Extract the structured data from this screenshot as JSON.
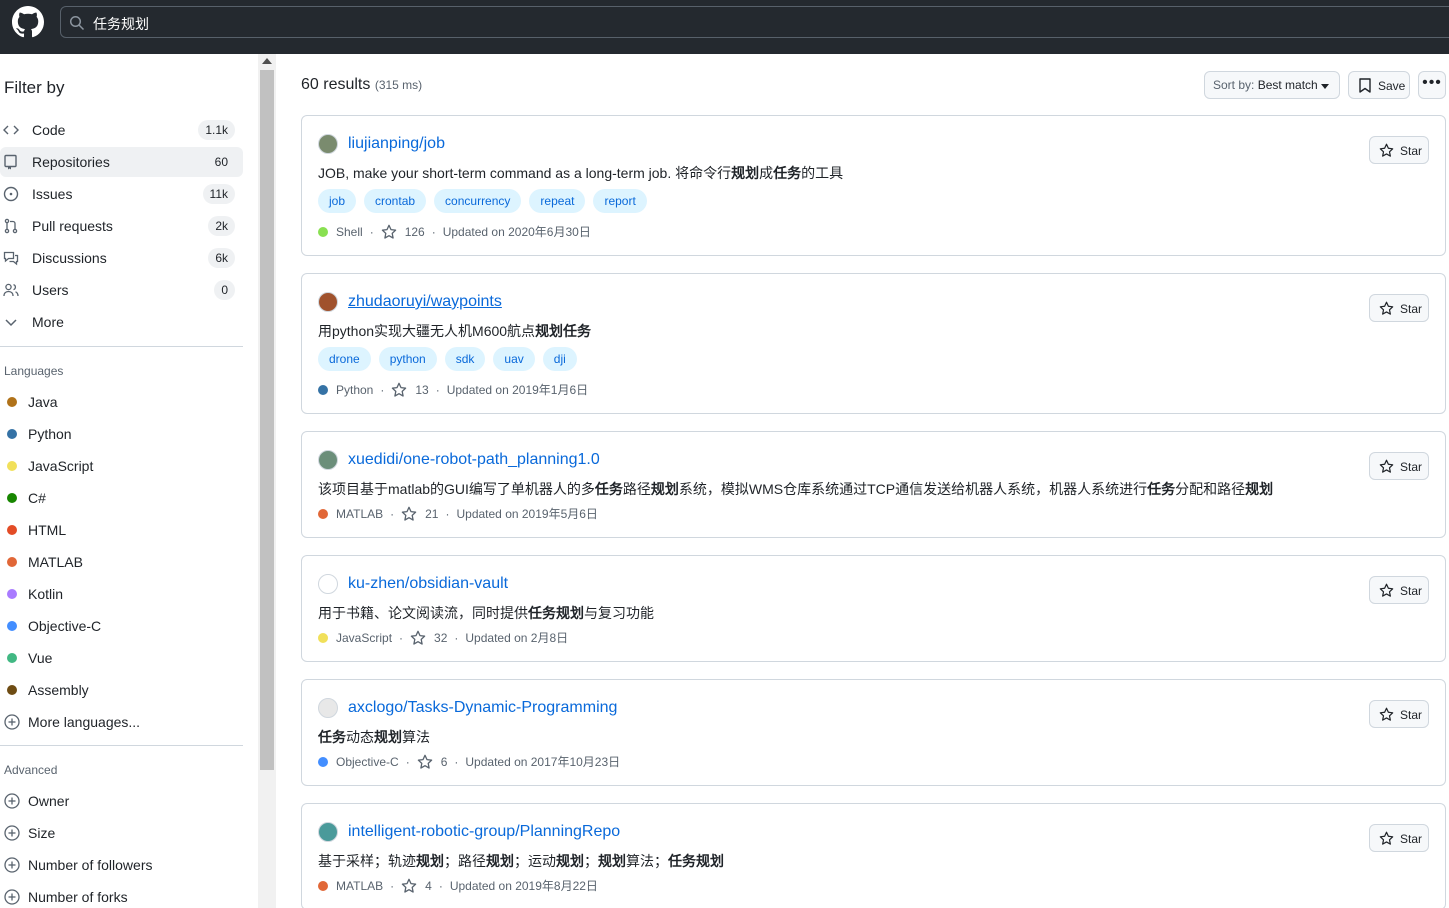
{
  "search": {
    "value": "任务规划"
  },
  "sidebar": {
    "filter_title": "Filter by",
    "types": [
      {
        "label": "Code",
        "count": "1.1k",
        "icon": "code-icon"
      },
      {
        "label": "Repositories",
        "count": "60",
        "icon": "repo-icon",
        "active": true
      },
      {
        "label": "Issues",
        "count": "11k",
        "icon": "issue-icon"
      },
      {
        "label": "Pull requests",
        "count": "2k",
        "icon": "pull-request-icon"
      },
      {
        "label": "Discussions",
        "count": "6k",
        "icon": "discussion-icon"
      },
      {
        "label": "Users",
        "count": "0",
        "icon": "people-icon"
      },
      {
        "label": "More",
        "icon": "chevron-down-icon"
      }
    ],
    "languages_label": "Languages",
    "languages": [
      {
        "label": "Java",
        "color": "#b07219"
      },
      {
        "label": "Python",
        "color": "#3572A5"
      },
      {
        "label": "JavaScript",
        "color": "#f1e05a"
      },
      {
        "label": "C#",
        "color": "#178600"
      },
      {
        "label": "HTML",
        "color": "#e34c26"
      },
      {
        "label": "MATLAB",
        "color": "#e16737"
      },
      {
        "label": "Kotlin",
        "color": "#A97BFF"
      },
      {
        "label": "Objective-C",
        "color": "#438eff"
      },
      {
        "label": "Vue",
        "color": "#41b883"
      },
      {
        "label": "Assembly",
        "color": "#6E4C13"
      }
    ],
    "more_languages": "More languages...",
    "advanced_label": "Advanced",
    "advanced": [
      "Owner",
      "Size",
      "Number of followers",
      "Number of forks"
    ]
  },
  "results": {
    "count": "60 results",
    "time": "(315 ms)",
    "sort_prefix": "Sort by:",
    "sort_value": "Best match",
    "save_label": "Save",
    "star_label": "Star",
    "items": [
      {
        "name": "liujianping/job",
        "desc": [
          [
            "JOB, make your short-term command as a long-term job. 将命令行",
            false
          ],
          [
            "规划",
            true
          ],
          [
            "成",
            false
          ],
          [
            "任务",
            true
          ],
          [
            "的工具",
            false
          ]
        ],
        "topics": [
          "job",
          "crontab",
          "concurrency",
          "repeat",
          "report"
        ],
        "language": "Shell",
        "lang_color": "#89e051",
        "stars": "126",
        "updated": "Updated on 2020年6月30日"
      },
      {
        "name": "zhudaoruyi/waypoints",
        "desc": [
          [
            "用python实现大疆无人机M600航点",
            false
          ],
          [
            "规划任务",
            true
          ]
        ],
        "topics": [
          "drone",
          "python",
          "sdk",
          "uav",
          "dji"
        ],
        "language": "Python",
        "lang_color": "#3572A5",
        "stars": "13",
        "updated": "Updated on 2019年1月6日"
      },
      {
        "name": "xuedidi/one-robot-path_planning1.0",
        "desc": [
          [
            "该项目基于matlab的GUI编写了单机器人的多",
            false
          ],
          [
            "任务",
            true
          ],
          [
            "路径",
            false
          ],
          [
            "规划",
            true
          ],
          [
            "系统，模拟WMS仓库系统通过TCP通信发送给机器人系统，机器人系统进行",
            false
          ],
          [
            "任务",
            true
          ],
          [
            "分配和路径",
            false
          ],
          [
            "规划",
            true
          ]
        ],
        "topics": [],
        "language": "MATLAB",
        "lang_color": "#e16737",
        "stars": "21",
        "updated": "Updated on 2019年5月6日"
      },
      {
        "name": "ku-zhen/obsidian-vault",
        "desc": [
          [
            "用于书籍、论文阅读流，同时提供",
            false
          ],
          [
            "任务规划",
            true
          ],
          [
            "与复习功能",
            false
          ]
        ],
        "topics": [],
        "language": "JavaScript",
        "lang_color": "#f1e05a",
        "stars": "32",
        "updated": "Updated on 2月8日"
      },
      {
        "name": "axclogo/Tasks-Dynamic-Programming",
        "desc": [
          [
            "任务",
            true
          ],
          [
            "动态",
            false
          ],
          [
            "规划",
            true
          ],
          [
            "算法",
            false
          ]
        ],
        "topics": [],
        "language": "Objective-C",
        "lang_color": "#438eff",
        "stars": "6",
        "updated": "Updated on 2017年10月23日"
      },
      {
        "name": "intelligent-robotic-group/PlanningRepo",
        "desc": [
          [
            "基于采样；轨迹",
            false
          ],
          [
            "规划",
            true
          ],
          [
            "；路径",
            false
          ],
          [
            "规划",
            true
          ],
          [
            "；运动",
            false
          ],
          [
            "规划",
            true
          ],
          [
            "；",
            false
          ],
          [
            "规划",
            true
          ],
          [
            "算法；",
            false
          ],
          [
            "任务规划",
            true
          ]
        ],
        "topics": [],
        "language": "MATLAB",
        "lang_color": "#e16737",
        "stars": "4",
        "updated": "Updated on 2019年8月22日"
      }
    ]
  }
}
